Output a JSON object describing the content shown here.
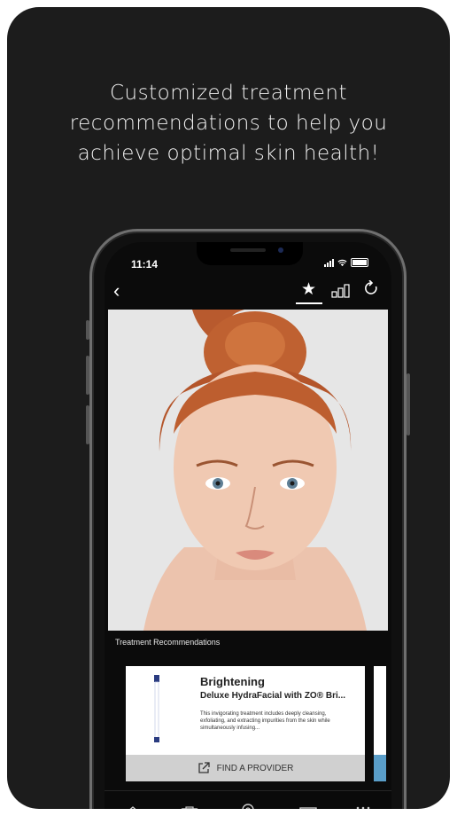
{
  "headline": "Customized treatment\nrecommendations to help you\nachieve optimal skin health!",
  "status": {
    "time": "11:14"
  },
  "nav": {
    "back_icon": "chevron-left-icon",
    "favorite_icon": "star-icon",
    "compare_icon": "bar-chart-icon",
    "refresh_icon": "refresh-icon"
  },
  "section_label": "Treatment Recommendations",
  "recommendation": {
    "title": "Brightening",
    "subtitle": "Deluxe HydraFacial with ZO® Bri...",
    "description": "This invigorating treatment includes deeply cleansing, exfoliating, and extracting impurities from the skin while simultaneously infusing...",
    "cta_label": "FIND A PROVIDER"
  },
  "tabs": [
    "home-icon",
    "camera-icon",
    "location-pin-icon",
    "card-icon",
    "grid-menu-icon"
  ],
  "colors": {
    "background": "#1c1c1c",
    "accent": "#5a9ec9"
  }
}
